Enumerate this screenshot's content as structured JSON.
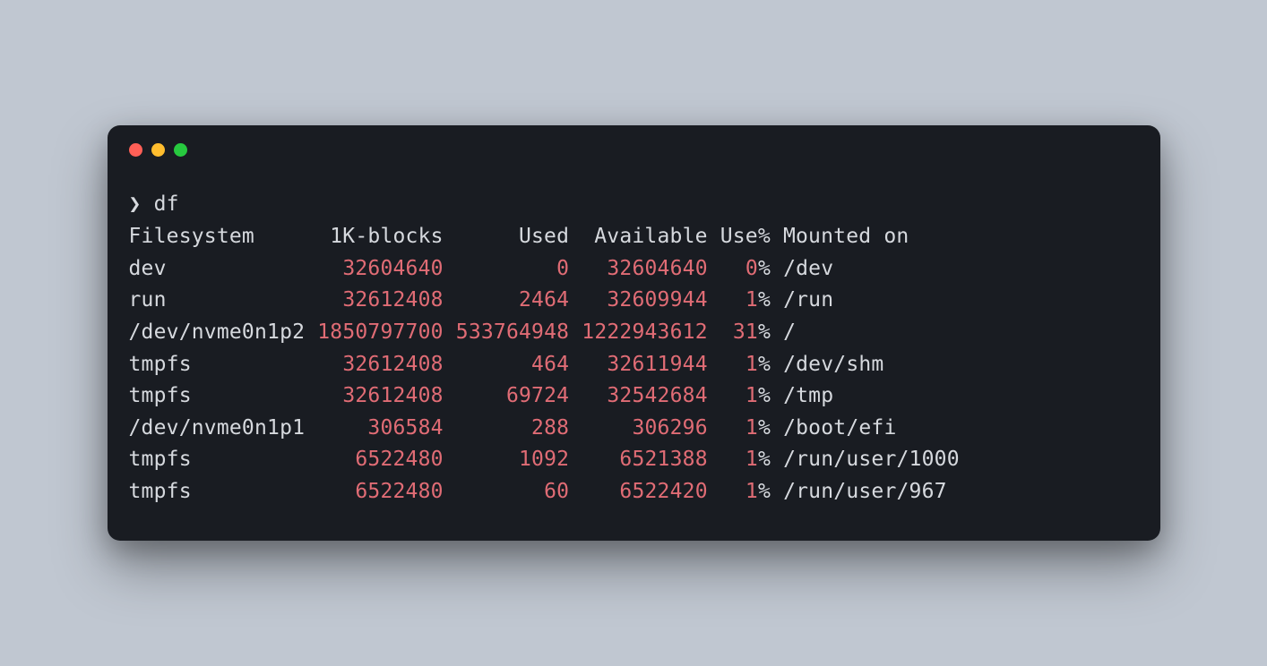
{
  "prompt": {
    "symbol": "❯",
    "command": "df"
  },
  "headers": [
    "Filesystem",
    "1K-blocks",
    "Used",
    "Available",
    "Use%",
    "Mounted on"
  ],
  "col_widths": {
    "fs": 15,
    "blocks": 10,
    "used": 9,
    "avail": 10,
    "usepct": 4
  },
  "rows": [
    {
      "filesystem": "dev",
      "blocks": "32604640",
      "used": "0",
      "available": "32604640",
      "use_pct": "0",
      "mounted_on": "/dev"
    },
    {
      "filesystem": "run",
      "blocks": "32612408",
      "used": "2464",
      "available": "32609944",
      "use_pct": "1",
      "mounted_on": "/run"
    },
    {
      "filesystem": "/dev/nvme0n1p2",
      "blocks": "1850797700",
      "used": "533764948",
      "available": "1222943612",
      "use_pct": "31",
      "mounted_on": "/"
    },
    {
      "filesystem": "tmpfs",
      "blocks": "32612408",
      "used": "464",
      "available": "32611944",
      "use_pct": "1",
      "mounted_on": "/dev/shm"
    },
    {
      "filesystem": "tmpfs",
      "blocks": "32612408",
      "used": "69724",
      "available": "32542684",
      "use_pct": "1",
      "mounted_on": "/tmp"
    },
    {
      "filesystem": "/dev/nvme0n1p1",
      "blocks": "306584",
      "used": "288",
      "available": "306296",
      "use_pct": "1",
      "mounted_on": "/boot/efi"
    },
    {
      "filesystem": "tmpfs",
      "blocks": "6522480",
      "used": "1092",
      "available": "6521388",
      "use_pct": "1",
      "mounted_on": "/run/user/1000"
    },
    {
      "filesystem": "tmpfs",
      "blocks": "6522480",
      "used": "60",
      "available": "6522420",
      "use_pct": "1",
      "mounted_on": "/run/user/967"
    }
  ]
}
